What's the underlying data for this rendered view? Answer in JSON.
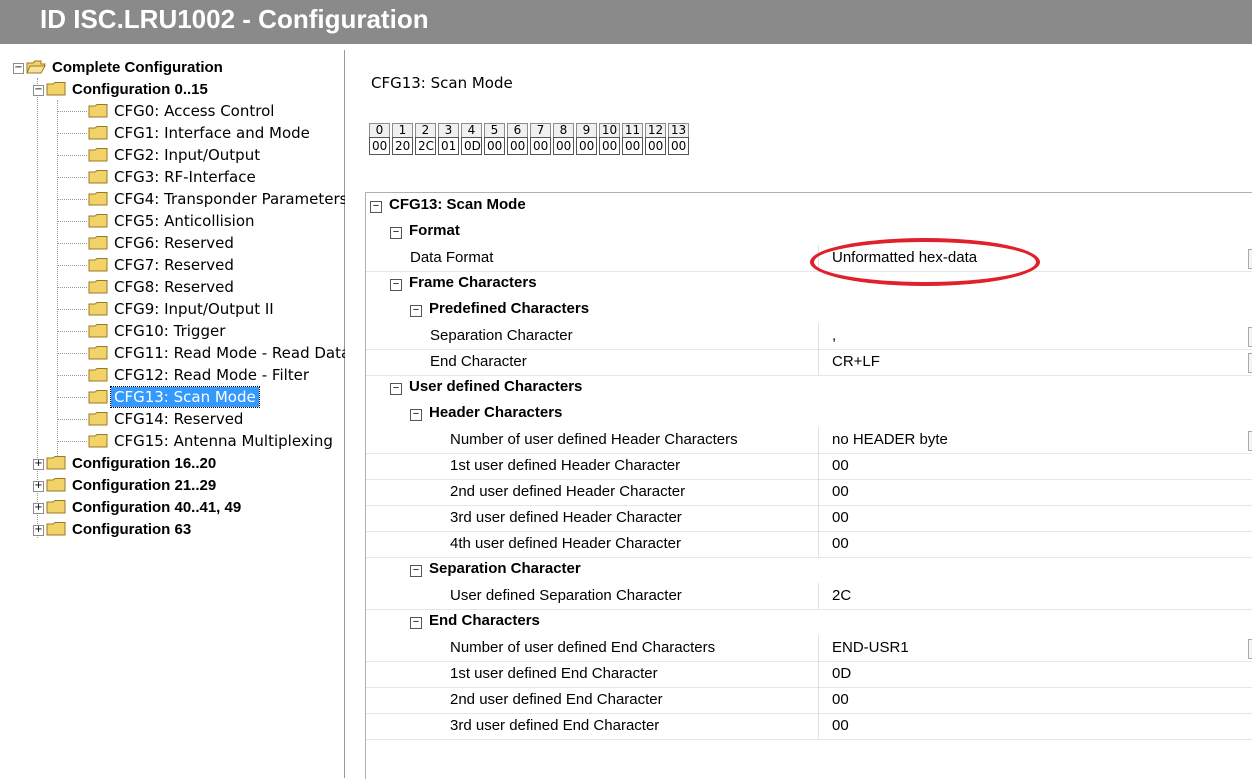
{
  "window": {
    "title": "ID ISC.LRU1002 - Configuration"
  },
  "tree": {
    "root": "Complete Configuration",
    "group_0_15": "Configuration 0..15",
    "items": [
      "CFG0: Access Control",
      "CFG1: Interface and Mode",
      "CFG2: Input/Output",
      "CFG3: RF-Interface",
      "CFG4: Transponder Parameters",
      "CFG5: Anticollision",
      "CFG6: Reserved",
      "CFG7: Reserved",
      "CFG8: Reserved",
      "CFG9: Input/Output II",
      "CFG10: Trigger",
      "CFG11: Read Mode - Read Data",
      "CFG12: Read Mode - Filter",
      "CFG13: Scan Mode",
      "CFG14: Reserved",
      "CFG15: Antenna Multiplexing"
    ],
    "selected_index": 13,
    "collapsed_groups": [
      "Configuration 16..20",
      "Configuration 21..29",
      "Configuration 40..41, 49",
      "Configuration 63"
    ]
  },
  "panel": {
    "heading": "CFG13: Scan Mode",
    "byte_indices": [
      "0",
      "1",
      "2",
      "3",
      "4",
      "5",
      "6",
      "7",
      "8",
      "9",
      "10",
      "11",
      "12",
      "13"
    ],
    "byte_values": [
      "00",
      "20",
      "2C",
      "01",
      "0D",
      "00",
      "00",
      "00",
      "00",
      "00",
      "00",
      "00",
      "00",
      "00"
    ]
  },
  "grid": {
    "root": "CFG13: Scan Mode",
    "format": "Format",
    "data_format_label": "Data Format",
    "data_format_value": "Unformatted hex-data",
    "frame_characters": "Frame Characters",
    "predefined_characters": "Predefined Characters",
    "separation_character_label": "Separation Character",
    "separation_character_value": ",",
    "end_character_label": "End Character",
    "end_character_value": "CR+LF",
    "user_defined_characters": "User defined Characters",
    "header_characters": "Header Characters",
    "num_header_label": "Number of user defined Header Characters",
    "num_header_value": "no HEADER byte",
    "header_1_label": "1st user defined Header Character",
    "header_1_value": "00",
    "header_2_label": "2nd user defined Header Character",
    "header_2_value": "00",
    "header_3_label": "3rd user defined Header Character",
    "header_3_value": "00",
    "header_4_label": "4th user defined Header Character",
    "header_4_value": "00",
    "separation_group": "Separation Character",
    "user_sep_label": "User defined Separation Character",
    "user_sep_value": "2C",
    "end_characters": "End Characters",
    "num_end_label": "Number of user defined End Characters",
    "num_end_value": "END-USR1",
    "end_1_label": "1st user defined End Character",
    "end_1_value": "0D",
    "end_2_label": "2nd user defined End Character",
    "end_2_value": "00",
    "end_3_label": "3rd user defined End Character",
    "end_3_value": "00"
  },
  "highlight": {
    "color": "#e0202a"
  }
}
